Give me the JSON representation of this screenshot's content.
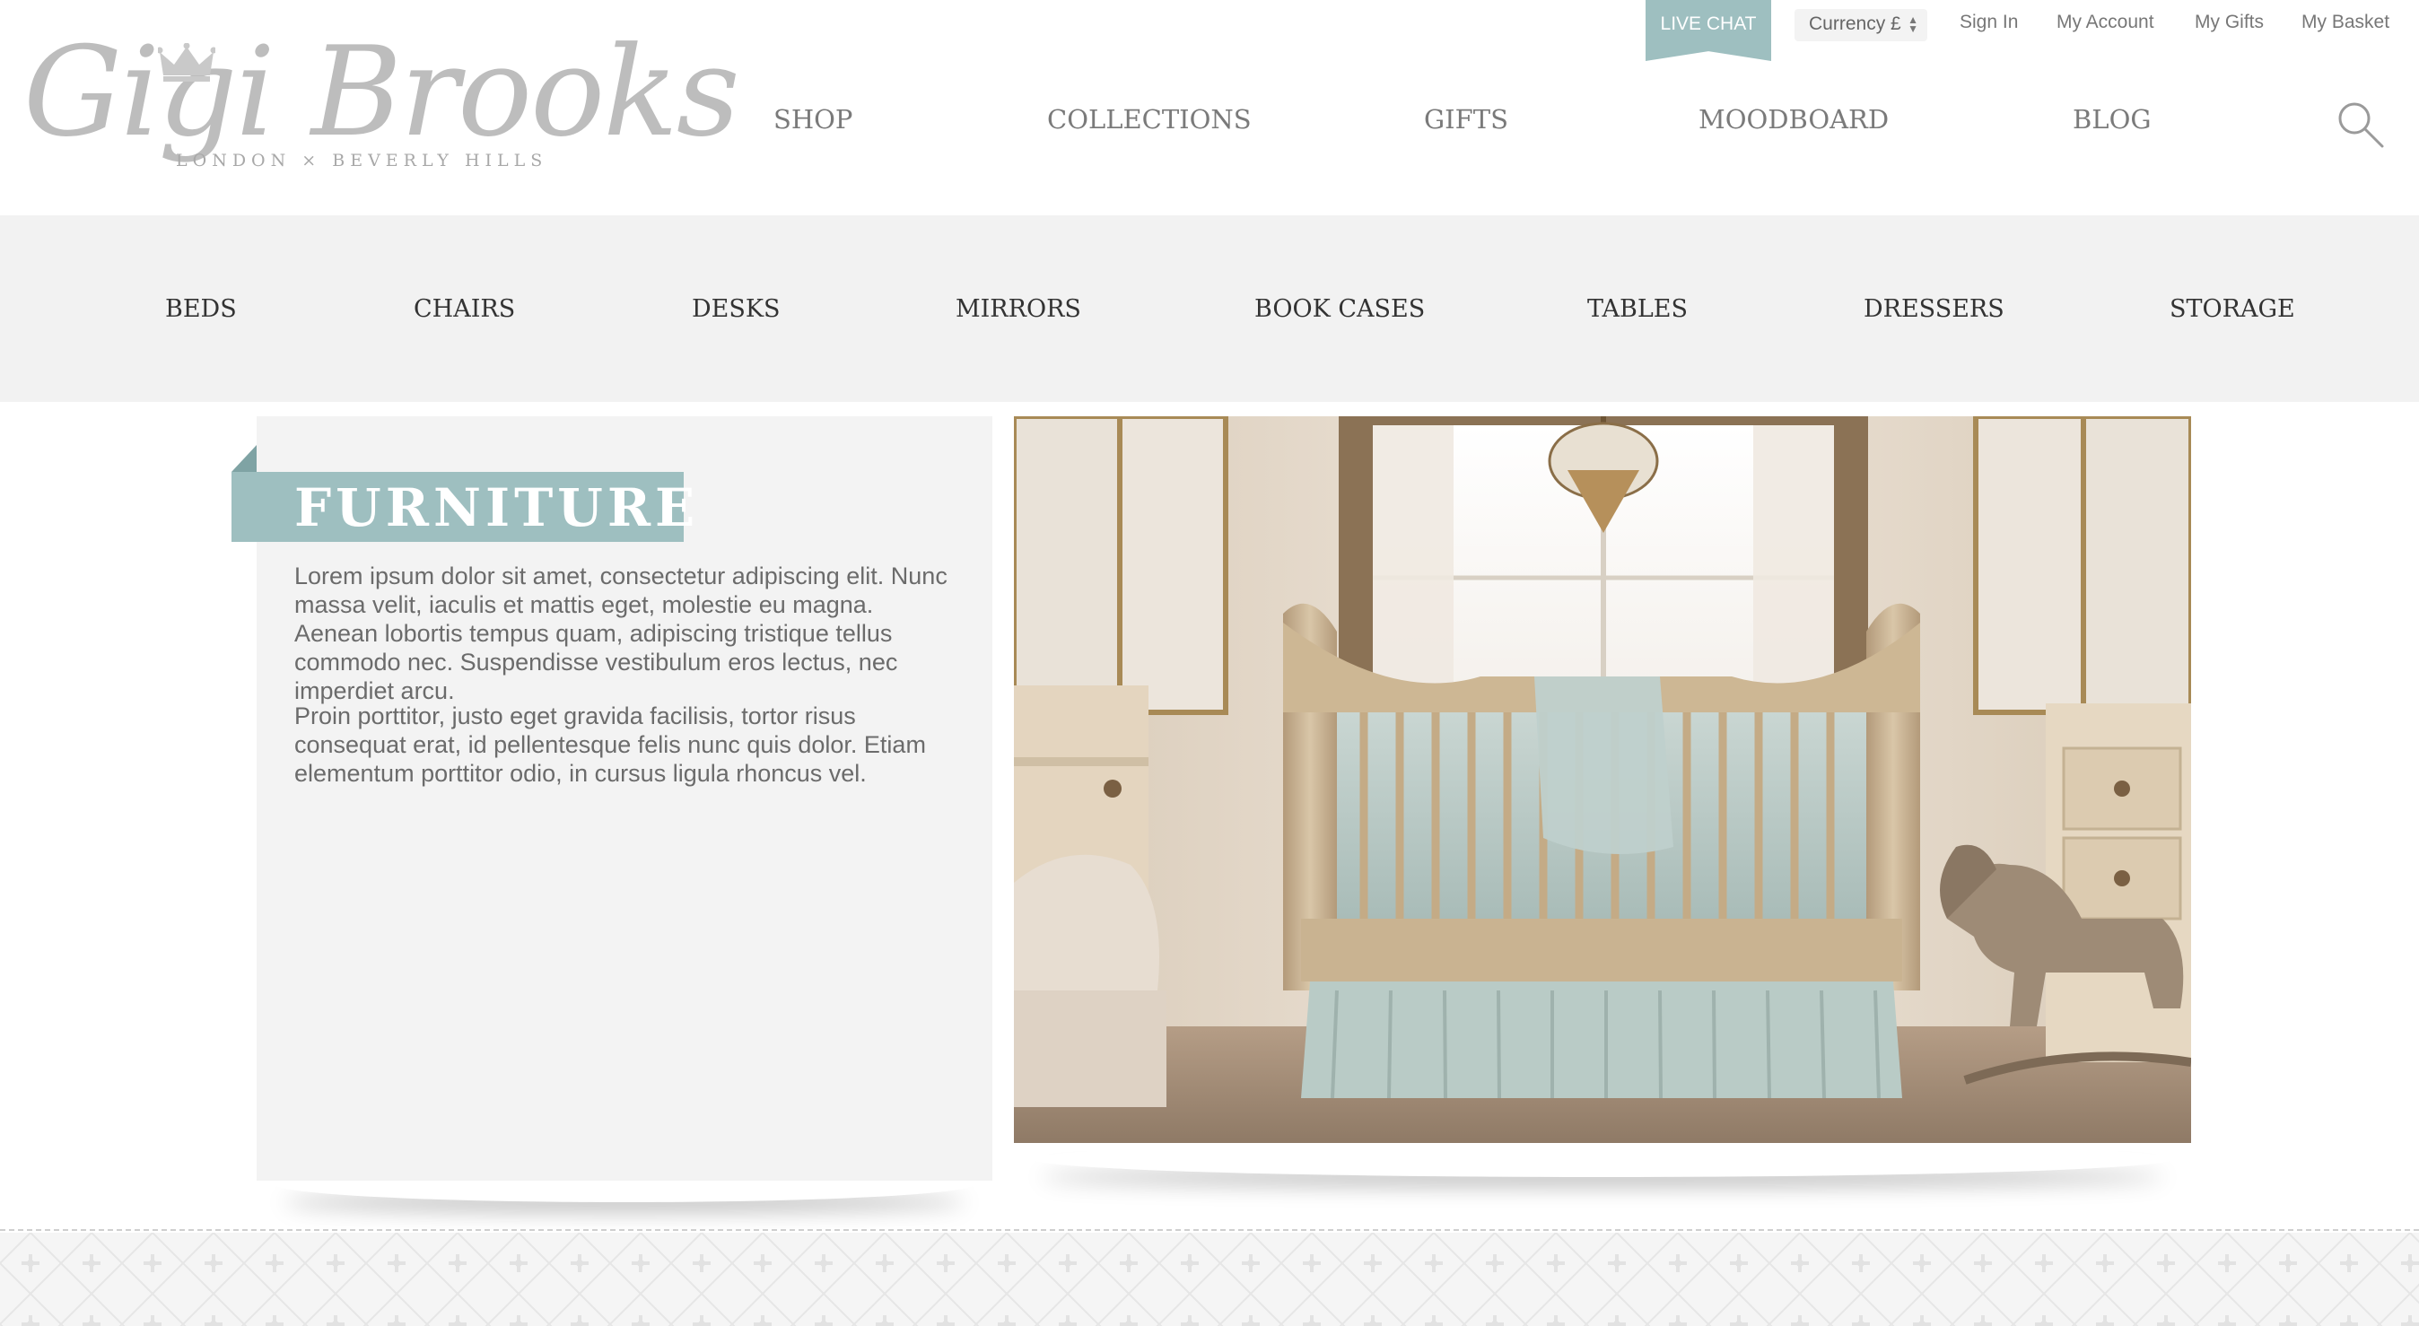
{
  "brand": {
    "name": "Gigi Brooks",
    "tagline": "LONDON × BEVERLY HILLS"
  },
  "topbar": {
    "live_chat": "LIVE CHAT",
    "currency": "Currency £",
    "sign_in": "Sign In",
    "my_account": "My Account",
    "my_gifts": "My Gifts",
    "my_basket": "My Basket"
  },
  "main_nav": {
    "items": [
      "SHOP",
      "COLLECTIONS",
      "GIFTS",
      "MOODBOARD",
      "BLOG"
    ]
  },
  "sub_nav": {
    "items": [
      "BEDS",
      "CHAIRS",
      "DESKS",
      "MIRRORS",
      "BOOK CASES",
      "TABLES",
      "DRESSERS",
      "STORAGE"
    ]
  },
  "feature": {
    "title": "FURNITURE",
    "paragraphs": [
      "Lorem ipsum dolor sit amet, consectetur adipiscing elit. Nunc massa velit, iaculis et mattis eget, molestie eu magna. Aenean lobortis tempus quam, adipiscing tristique tellus commodo nec. Suspendisse vestibulum eros lectus, nec imperdiet arcu.",
      "Proin porttitor, justo eget gravida facilisis, tortor risus consequat erat, id pellentesque felis nunc quis dolor. Etiam elementum porttitor odio, in cursus ligula rhoncus vel."
    ]
  },
  "colors": {
    "accent": "#9ebfc0",
    "subnav_bg": "#f2f2f2",
    "panel_bg": "#f3f3f3"
  },
  "icons": {
    "search": "search-icon",
    "crown": "crown-icon"
  }
}
